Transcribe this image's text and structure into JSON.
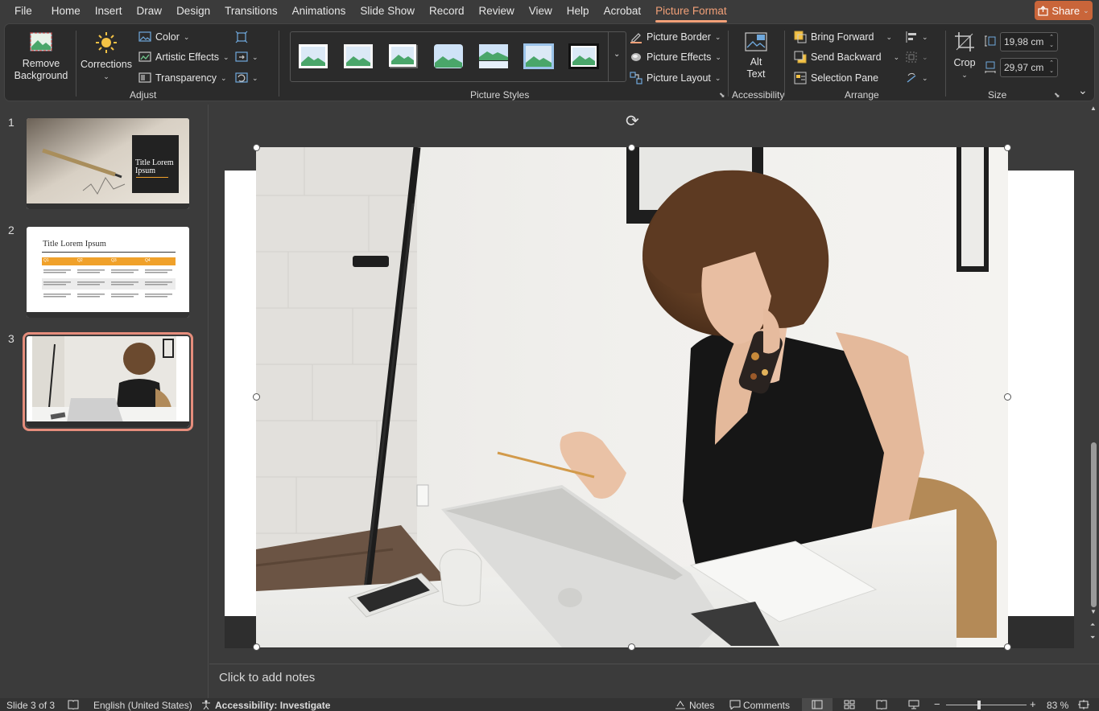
{
  "menu": {
    "items": [
      "File",
      "Home",
      "Insert",
      "Draw",
      "Design",
      "Transitions",
      "Animations",
      "Slide Show",
      "Record",
      "Review",
      "View",
      "Help",
      "Acrobat",
      "Picture Format"
    ],
    "active": "Picture Format",
    "share": "Share"
  },
  "ribbon": {
    "adjust": {
      "remove_bg": "Remove Background",
      "corrections": "Corrections",
      "color": "Color",
      "artistic": "Artistic Effects",
      "transparency": "Transparency",
      "label": "Adjust"
    },
    "styles": {
      "label": "Picture Styles"
    },
    "picture_opts": {
      "border": "Picture Border",
      "effects": "Picture Effects",
      "layout": "Picture Layout"
    },
    "accessibility": {
      "alt_text": "Alt Text",
      "label": "Accessibility"
    },
    "arrange": {
      "bring_forward": "Bring Forward",
      "send_backward": "Send Backward",
      "selection_pane": "Selection Pane",
      "label": "Arrange"
    },
    "size": {
      "crop": "Crop",
      "height": "19,98 cm",
      "width": "29,97 cm",
      "label": "Size"
    }
  },
  "slides": [
    {
      "num": "1",
      "title": "Title Lorem Ipsum"
    },
    {
      "num": "2",
      "title": "Title Lorem Ipsum",
      "table_headers": [
        "Q1",
        "Q2",
        "Q3",
        "Q4"
      ]
    },
    {
      "num": "3"
    }
  ],
  "notes_placeholder": "Click to add notes",
  "status": {
    "slide": "Slide 3 of 3",
    "language": "English (United States)",
    "accessibility": "Accessibility: Investigate",
    "notes": "Notes",
    "comments": "Comments",
    "zoom": "83 %"
  },
  "colors": {
    "accent": "#f2a078",
    "share": "#c9653a",
    "selection": "#e58d7c",
    "orange": "#f0a12a"
  }
}
